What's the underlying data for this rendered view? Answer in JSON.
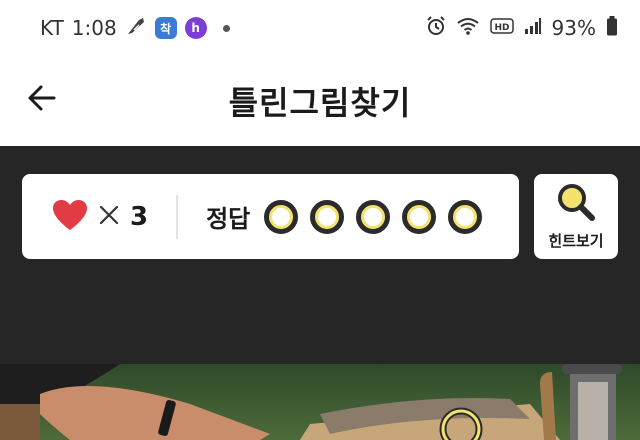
{
  "status_bar": {
    "carrier": "KT",
    "time": "1:08",
    "battery": "93%",
    "icons": [
      "feather-icon",
      "app-icon-blue",
      "app-icon-purple",
      "alarm-icon",
      "wifi-icon",
      "hd-icon",
      "signal-icon",
      "battery-icon"
    ]
  },
  "header": {
    "title": "틀린그림찾기",
    "back_icon": "back-arrow-icon"
  },
  "game": {
    "lives_icon": "heart-icon",
    "lives_count": "3",
    "answer_label": "정답",
    "answer_slots": 5,
    "hint_label": "힌트보기",
    "hint_icon": "magnifier-icon"
  },
  "colors": {
    "dark_bg": "#262626",
    "heart": "#e23b44",
    "slot_fill": "#f3e36e"
  }
}
